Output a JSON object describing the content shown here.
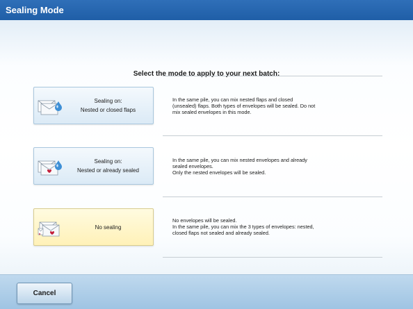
{
  "window": {
    "title": "Sealing Mode"
  },
  "instruction": "Select the mode to apply to your next batch:",
  "modes": [
    {
      "label_line1": "Sealing on:",
      "label_line2": "Nested or closed flaps",
      "icon": "nested-closed-flaps-icon",
      "description": [
        "In the same pile, you can mix nested flaps and closed",
        "(unsealed) flaps. Both types of envelopes will be sealed. Do not",
        "mix sealed envelopes in this mode."
      ]
    },
    {
      "label_line1": "Sealing on:",
      "label_line2": "Nested or already sealed",
      "icon": "nested-already-sealed-icon",
      "description": [
        "In the same pile, you can mix nested envelopes and already",
        "sealed envelopes.",
        "Only the nested envelopes will be sealed."
      ]
    },
    {
      "label_line1": "No sealing",
      "label_line2": "",
      "icon": "no-sealing-icon",
      "selected": true,
      "description": [
        "No envelopes will be sealed.",
        "In the same pile, you can mix the 3 types of envelopes: nested,",
        "closed flaps not sealed and already sealed."
      ]
    }
  ],
  "footer": {
    "cancel_label": "Cancel"
  },
  "colors": {
    "title_bar": "#2f6fb8",
    "card_normal": "#dbeaf6",
    "card_selected": "#fff1b8",
    "water_drop": "#3d8fd6",
    "seal_red": "#c3203b"
  }
}
